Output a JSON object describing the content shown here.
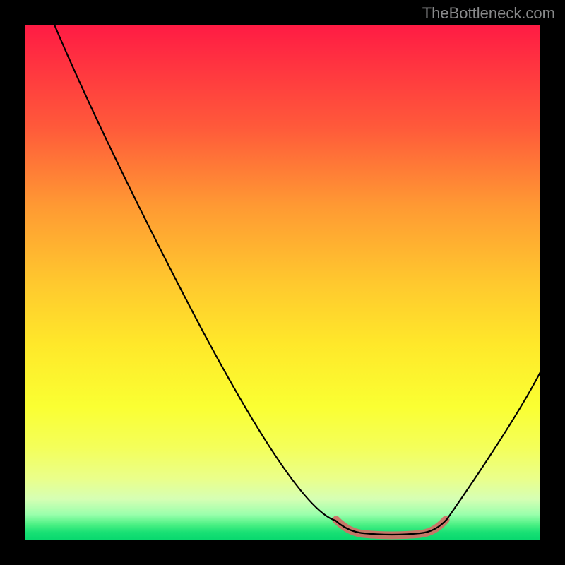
{
  "attribution": "TheBottleneck.com",
  "colors": {
    "background": "#000000",
    "gradient_top": "#ff1b44",
    "gradient_mid": "#ffe82a",
    "gradient_bottom": "#08d86e",
    "curve": "#000000",
    "highlight": "#d36e66",
    "attribution_text": "#88898a"
  },
  "chart_data": {
    "type": "line",
    "title": "",
    "xlabel": "",
    "ylabel": "",
    "xlim": [
      0,
      100
    ],
    "ylim": [
      0,
      100
    ],
    "series": [
      {
        "name": "bottleneck-curve",
        "x": [
          6,
          12,
          20,
          28,
          34,
          40,
          46,
          52,
          58,
          60,
          66,
          72,
          78,
          82,
          88,
          94,
          100
        ],
        "y": [
          100,
          88,
          72,
          56,
          44,
          34,
          24,
          14,
          6,
          4,
          1,
          1,
          1,
          4,
          12,
          24,
          33
        ]
      }
    ],
    "annotations": [
      {
        "name": "optimum-range",
        "x_range": [
          60,
          82
        ],
        "y": 1,
        "color": "#d36e66"
      }
    ],
    "background_gradient": {
      "direction": "vertical",
      "stops": [
        {
          "pos": 0.0,
          "color": "#ff1b44"
        },
        {
          "pos": 0.2,
          "color": "#ff5a3a"
        },
        {
          "pos": 0.35,
          "color": "#ff9933"
        },
        {
          "pos": 0.5,
          "color": "#ffc82e"
        },
        {
          "pos": 0.62,
          "color": "#ffe82a"
        },
        {
          "pos": 0.74,
          "color": "#faff32"
        },
        {
          "pos": 0.82,
          "color": "#f4ff5a"
        },
        {
          "pos": 0.88,
          "color": "#eaff8a"
        },
        {
          "pos": 0.92,
          "color": "#d6ffb4"
        },
        {
          "pos": 0.95,
          "color": "#9affac"
        },
        {
          "pos": 0.97,
          "color": "#4af083"
        },
        {
          "pos": 0.985,
          "color": "#17e074"
        },
        {
          "pos": 1.0,
          "color": "#08d86e"
        }
      ]
    }
  }
}
